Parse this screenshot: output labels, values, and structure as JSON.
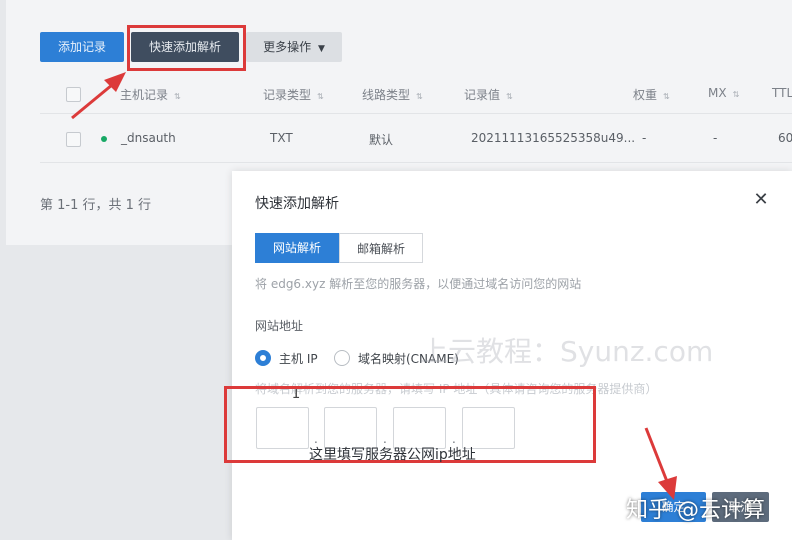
{
  "colors": {
    "primary": "#2d7fd6",
    "annotation_red": "#dc3a3a",
    "status_green": "#17a865"
  },
  "toolbar": {
    "add_record": "添加记录",
    "quick_add": "快速添加解析",
    "more_actions": "更多操作",
    "more_caret": "▼"
  },
  "table": {
    "sort_icon": "⇅",
    "headers": {
      "host": "主机记录",
      "type": "记录类型",
      "line": "线路类型",
      "value": "记录值",
      "weight": "权重",
      "mx": "MX",
      "ttl": "TTL"
    },
    "rows": [
      {
        "host": "_dnsauth",
        "type": "TXT",
        "line": "默认",
        "value": "20211113165525358u49...",
        "weight": "-",
        "mx": "-",
        "ttl": "60"
      }
    ]
  },
  "pager": "第 1-1 行，共 1 行",
  "modal": {
    "title": "快速添加解析",
    "close": "✕",
    "tabs": [
      "网站解析",
      "邮箱解析"
    ],
    "description": "将 edg6.xyz 解析至您的服务器，以便通过域名访问您的网站",
    "field_label": "网站地址",
    "radio_ip": "主机 IP",
    "radio_cname": "域名映射(CNAME)",
    "hint": "将域名解析到您的服务器，请填写 IP 地址（具体请咨询您的服务器提供商）",
    "ip_separator": ".",
    "submit": "确定",
    "cancel": "取消"
  },
  "annotation_text": "这里填写服务器公网ip地址",
  "watermark": "上云教程：Syunz.com",
  "zhihu_watermark": "知乎 @云计算",
  "cursor_glyph": "I"
}
